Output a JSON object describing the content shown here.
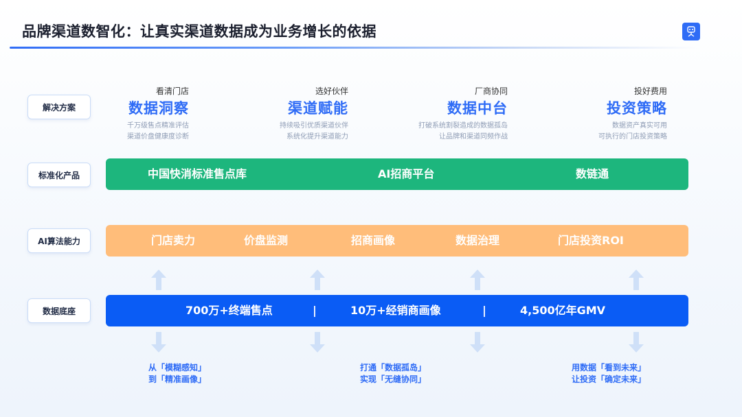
{
  "title": "品牌渠道数智化：让真实渠道数据成为业务增长的依据",
  "row_labels": [
    "解决方案",
    "标准化产品",
    "AI算法能力",
    "数据底座"
  ],
  "solutions": [
    {
      "sub": "看清门店",
      "main": "数据洞察",
      "d1": "千万级售点精准评估",
      "d2": "渠道价盘健康度诊断"
    },
    {
      "sub": "选好伙伴",
      "main": "渠道赋能",
      "d1": "持续吸引优质渠道伙伴",
      "d2": "系统化提升渠道能力"
    },
    {
      "sub": "厂商协同",
      "main": "数据中台",
      "d1": "打破系统割裂造成的数据孤岛",
      "d2": "让品牌和渠道同频作战"
    },
    {
      "sub": "投好费用",
      "main": "投资策略",
      "d1": "数据资产真实可用",
      "d2": "可执行的门店投资策略"
    }
  ],
  "products": [
    "中国快消标准售点库",
    "AI招商平台",
    "数链通"
  ],
  "ai": [
    "门店卖力",
    "价盘监测",
    "招商画像",
    "数据治理",
    "门店投资ROI"
  ],
  "base": [
    "700万+终端售点",
    "|",
    "10万+经销商画像",
    "|",
    "4,500亿年GMV"
  ],
  "notes": [
    {
      "l1": "从「模糊感知」",
      "l2": "到「精准画像」"
    },
    {
      "l1": "打通「数据孤岛」",
      "l2": "实现「无缝协同」"
    },
    {
      "l1": "用数据「看到未来」",
      "l2": "让投资「确定未来」"
    }
  ],
  "colors": {
    "primary": "#2f6cf6",
    "green": "#1db67d",
    "orange": "#ffbd7a",
    "blue": "#0a5cf5"
  },
  "icons": [
    "logo-icon",
    "arrow-up-icon",
    "arrow-down-icon"
  ]
}
